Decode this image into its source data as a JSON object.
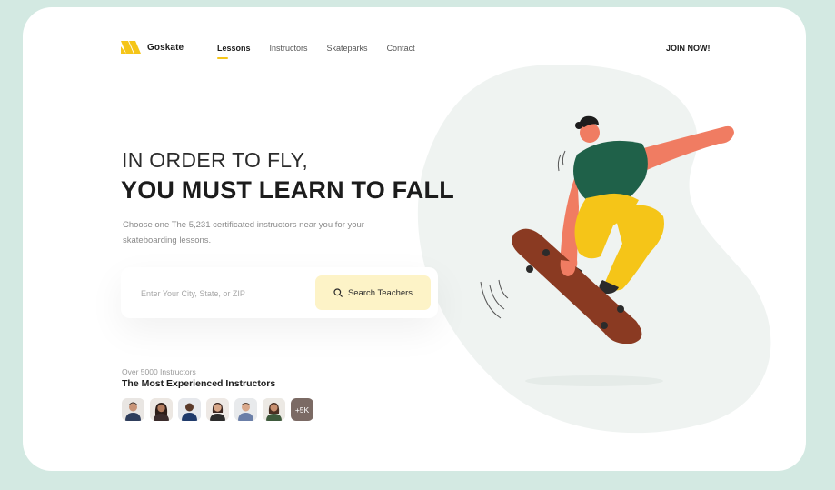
{
  "brand": {
    "name": "Goskate",
    "accent": "#f5c518"
  },
  "nav": {
    "items": [
      {
        "label": "Lessons",
        "active": true
      },
      {
        "label": "Instructors",
        "active": false
      },
      {
        "label": "Skateparks",
        "active": false
      },
      {
        "label": "Contact",
        "active": false
      }
    ],
    "cta": "JOIN NOW!"
  },
  "hero": {
    "subtitle": "IN ORDER TO FLY,",
    "title": "YOU MUST LEARN TO FALL",
    "description": "Choose one The 5,231 certificated instructors near you for your skateboarding lessons."
  },
  "search": {
    "placeholder": "Enter Your City, State, or ZIP",
    "button_label": "Search Teachers",
    "icon": "search-icon"
  },
  "instructors": {
    "count_label": "Over 5000 Instructors",
    "title": "The Most Experienced Instructors",
    "more_label": "+5K"
  },
  "colors": {
    "background": "#d3e9e2",
    "card": "#ffffff",
    "blob": "#eff3f1",
    "search_button": "#fdf3c7"
  }
}
